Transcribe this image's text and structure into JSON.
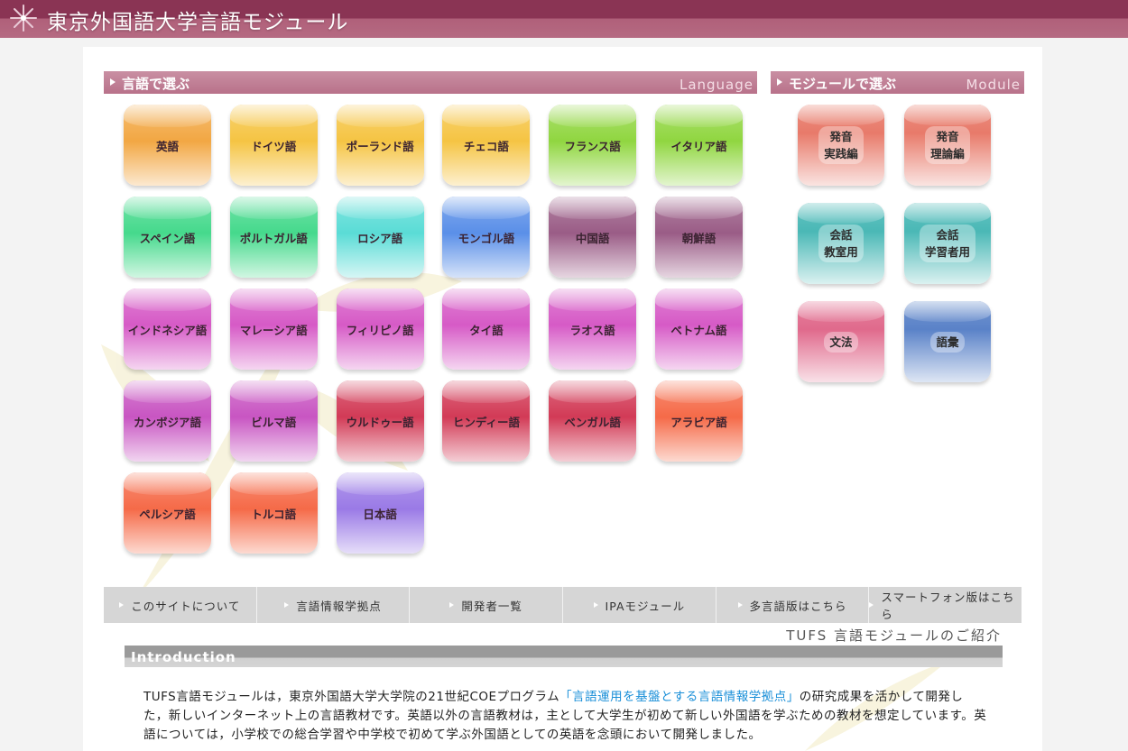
{
  "header": {
    "title": "東京外国語大学言語モジュール",
    "logo_icon": "asterisk-flower-icon"
  },
  "language_section": {
    "title": "言語で選ぶ",
    "title_en": "Language",
    "languages": [
      {
        "label": "英語",
        "color": "#f2a743"
      },
      {
        "label": "ドイツ語",
        "color": "#f5c443"
      },
      {
        "label": "ポーランド語",
        "color": "#f5c443"
      },
      {
        "label": "チェコ語",
        "color": "#f5c443"
      },
      {
        "label": "フランス語",
        "color": "#90d640"
      },
      {
        "label": "イタリア語",
        "color": "#90d640"
      },
      {
        "label": "スペイン語",
        "color": "#45d98c"
      },
      {
        "label": "ポルトガル語",
        "color": "#45d98c"
      },
      {
        "label": "ロシア語",
        "color": "#5adcd6"
      },
      {
        "label": "モンゴル語",
        "color": "#5a8fe8"
      },
      {
        "label": "中国語",
        "color": "#9a5c86"
      },
      {
        "label": "朝鮮語",
        "color": "#9a5c86"
      },
      {
        "label": "インドネシア語",
        "color": "#d65ac6"
      },
      {
        "label": "マレーシア語",
        "color": "#d65ac6"
      },
      {
        "label": "フィリピノ語",
        "color": "#d65ac6"
      },
      {
        "label": "タイ語",
        "color": "#d65ac6"
      },
      {
        "label": "ラオス語",
        "color": "#d65ac6"
      },
      {
        "label": "ベトナム語",
        "color": "#d65ac6"
      },
      {
        "label": "カンボジア語",
        "color": "#c855c2"
      },
      {
        "label": "ビルマ語",
        "color": "#c855c2"
      },
      {
        "label": "ウルドゥー語",
        "color": "#d23a56"
      },
      {
        "label": "ヒンディー語",
        "color": "#d23a56"
      },
      {
        "label": "ベンガル語",
        "color": "#d23a56"
      },
      {
        "label": "アラビア語",
        "color": "#f56a48"
      },
      {
        "label": "ペルシア語",
        "color": "#f56a48"
      },
      {
        "label": "トルコ語",
        "color": "#f56a48"
      },
      {
        "label": "日本語",
        "color": "#9a7ae6"
      }
    ]
  },
  "module_section": {
    "title": "モジュールで選ぶ",
    "title_en": "Module",
    "modules": [
      {
        "label": "発音\n実践編",
        "color": "#e87a6a"
      },
      {
        "label": "発音\n理論編",
        "color": "#e87a6a"
      },
      {
        "label": "会話\n教室用",
        "color": "#4ab8b6"
      },
      {
        "label": "会話\n学習者用",
        "color": "#4ab8b6"
      },
      {
        "label": "文法",
        "color": "#e06a8c"
      },
      {
        "label": "語彙",
        "color": "#5a82c8"
      }
    ]
  },
  "nav": {
    "items": [
      "このサイトについて",
      "言語情報学拠点",
      "開発者一覧",
      "IPAモジュール",
      "多言語版はこちら",
      "スマートフォン版はこちら"
    ]
  },
  "intro": {
    "subtitle": "TUFS 言語モジュールのご紹介",
    "bar_title": "Introduction",
    "text_before_link": "TUFS言語モジュールは，東京外国語大学大学院の21世紀COEプログラム",
    "link_text": "「言語運用を基盤とする言語情報学拠点」",
    "text_after_link": "の研究成果を活かして開発した，新しいインターネット上の言語教材です。英語以外の言語教材は，主として大学生が初めて新しい外国語を学ぶための教材を想定しています。英語については，小学校での総合学習や中学校で初めて学ぶ外国語としての英語を念頭において開発しました。"
  }
}
